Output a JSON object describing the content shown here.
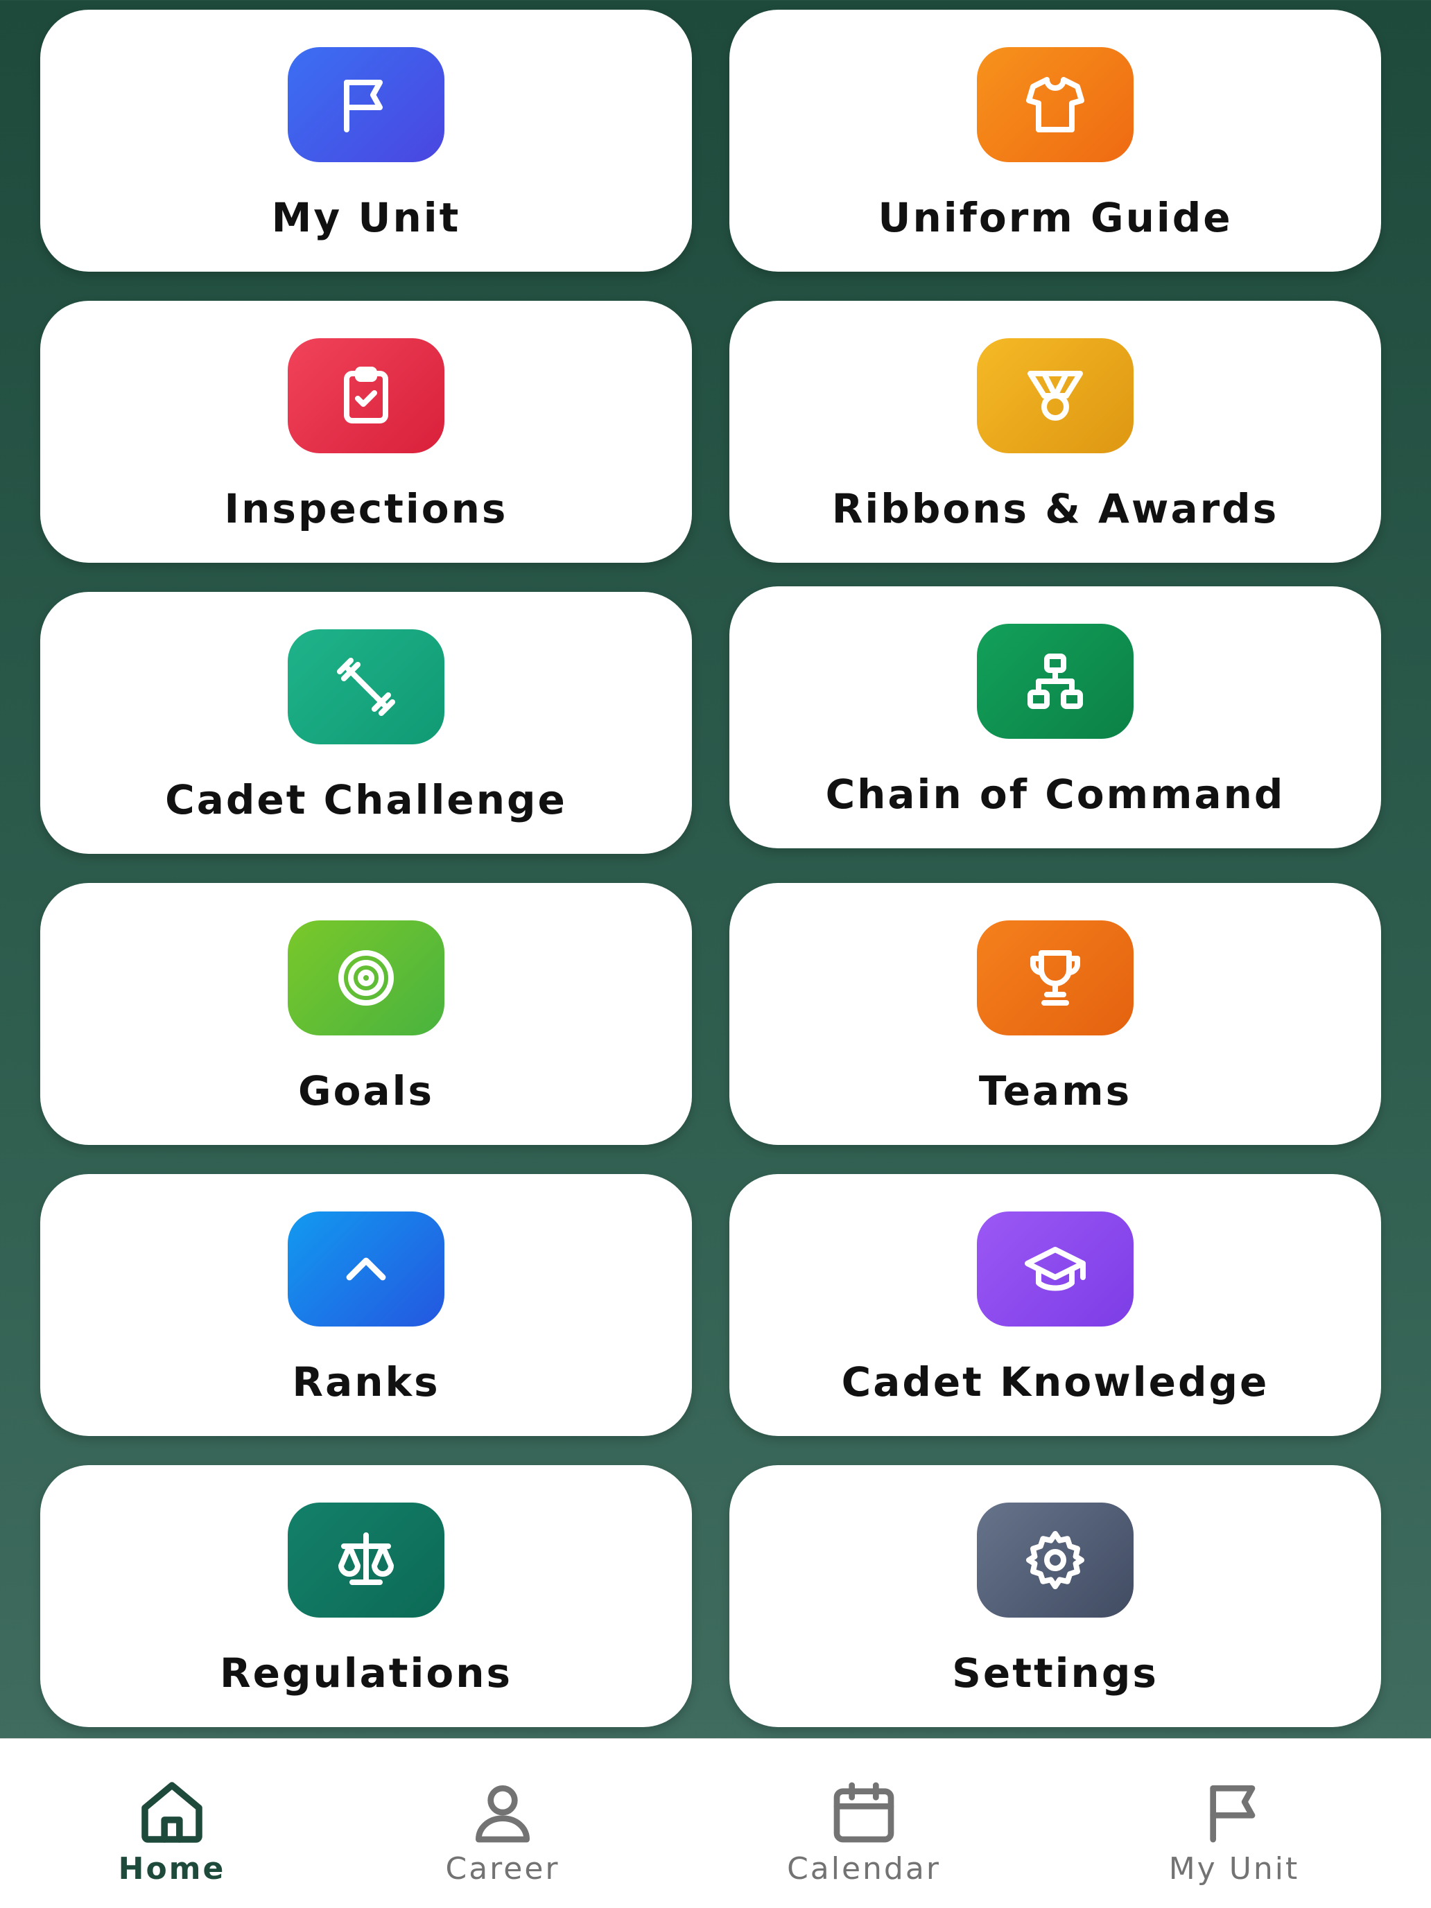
{
  "grid": [
    {
      "label": "My Unit",
      "icon": "flag-icon",
      "colors": [
        "#3b6ff3",
        "#4a46e0"
      ]
    },
    {
      "label": "Uniform Guide",
      "icon": "shirt-icon",
      "colors": [
        "#f7921c",
        "#ef6a12"
      ]
    },
    {
      "label": "Inspections",
      "icon": "clipboard-check-icon",
      "colors": [
        "#f0435a",
        "#d9203b"
      ]
    },
    {
      "label": "Ribbons & Awards",
      "icon": "medal-icon",
      "colors": [
        "#f5b926",
        "#de9712"
      ]
    },
    {
      "label": "Cadet Challenge",
      "icon": "dumbbell-icon",
      "colors": [
        "#1fb38a",
        "#109a74"
      ]
    },
    {
      "label": "Chain of Command",
      "icon": "hierarchy-icon",
      "colors": [
        "#12a05a",
        "#0c8146"
      ]
    },
    {
      "label": "Goals",
      "icon": "target-icon",
      "colors": [
        "#7ac82a",
        "#49b33f"
      ]
    },
    {
      "label": "Teams",
      "icon": "trophy-icon",
      "colors": [
        "#f5801c",
        "#e4620f"
      ]
    },
    {
      "label": "Ranks",
      "icon": "chevron-up-icon",
      "colors": [
        "#129af0",
        "#2457e0"
      ]
    },
    {
      "label": "Cadet Knowledge",
      "icon": "graduation-cap-icon",
      "colors": [
        "#9b58f5",
        "#7d3de6"
      ]
    },
    {
      "label": "Regulations",
      "icon": "scale-icon",
      "colors": [
        "#14806a",
        "#0c6a55"
      ]
    },
    {
      "label": "Settings",
      "icon": "gear-icon",
      "colors": [
        "#66738a",
        "#414c63"
      ]
    }
  ],
  "tabs": [
    {
      "label": "Home",
      "icon": "home-icon",
      "active": true
    },
    {
      "label": "Career",
      "icon": "person-icon",
      "active": false
    },
    {
      "label": "Calendar",
      "icon": "calendar-icon",
      "active": false
    },
    {
      "label": "My Unit",
      "icon": "flag-icon",
      "active": false
    }
  ],
  "colors": {
    "background_top": "#1e4a3c",
    "background_bottom": "#436f62",
    "tab_active": "#1e4a3c",
    "tab_inactive": "#737373"
  }
}
